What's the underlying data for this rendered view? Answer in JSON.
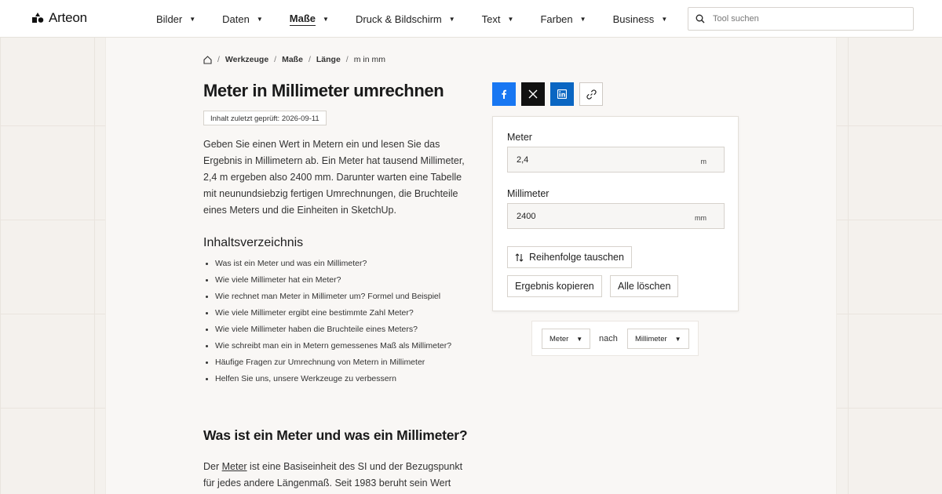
{
  "brand": {
    "name": "Arteon",
    "logo_icon": "arteon-logo-icon"
  },
  "nav": {
    "items": [
      {
        "label": "Bilder",
        "active": false
      },
      {
        "label": "Daten",
        "active": false
      },
      {
        "label": "Maße",
        "active": true
      },
      {
        "label": "Druck & Bildschirm",
        "active": false
      },
      {
        "label": "Text",
        "active": false
      },
      {
        "label": "Farben",
        "active": false
      },
      {
        "label": "Business",
        "active": false
      }
    ],
    "caret": "▼"
  },
  "search": {
    "placeholder": "Tool suchen",
    "value": ""
  },
  "breadcrumb": {
    "home_icon": "home-icon",
    "items": [
      "Werkzeuge",
      "Maße",
      "Länge"
    ],
    "current": "m in mm",
    "separator": "/"
  },
  "page": {
    "title": "Meter in Millimeter umrechnen",
    "badge": "Inhalt zuletzt geprüft: 2026-09-11",
    "intro": "Geben Sie einen Wert in Metern ein und lesen Sie das Ergebnis in Millimetern ab. Ein Meter hat tausend Millimeter, 2,4 m ergeben also 2400 mm. Darunter warten eine Tabelle mit neunundsiebzig fertigen Umrechnungen, die Bruchteile eines Meters und die Einheiten in SketchUp."
  },
  "toc": {
    "title": "Inhaltsverzeichnis",
    "items": [
      "Was ist ein Meter und was ein Millimeter?",
      "Wie viele Millimeter hat ein Meter?",
      "Wie rechnet man Meter in Millimeter um? Formel und Beispiel",
      "Wie viele Millimeter ergibt eine bestimmte Zahl Meter?",
      "Wie viele Millimeter haben die Bruchteile eines Meters?",
      "Wie schreibt man ein in Metern gemessenes Maß als Millimeter?",
      "Häufige Fragen zur Umrechnung von Metern in Millimeter",
      "Helfen Sie uns, unsere Werkzeuge zu verbessern"
    ]
  },
  "section": {
    "title": "Was ist ein Meter und was ein Millimeter?",
    "text_before": "Der ",
    "link": "Meter",
    "text_after": " ist eine Basiseinheit des SI und der Bezugspunkt für jedes andere Längenmaß. Seit 1983 beruht sein Wert"
  },
  "share": {
    "facebook_icon": "facebook-icon",
    "x_icon": "x-icon",
    "linkedin_icon": "linkedin-icon",
    "link_icon": "link-icon",
    "colors": {
      "facebook": "#1877f2",
      "x": "#111111",
      "linkedin": "#0a66c2"
    }
  },
  "converter": {
    "from": {
      "label": "Meter",
      "value": "2,4",
      "unit": "m"
    },
    "to": {
      "label": "Millimeter",
      "value": "2400",
      "unit": "mm"
    },
    "swap_label": "Reihenfolge tauschen",
    "copy_label": "Ergebnis kopieren",
    "clear_label": "Alle löschen"
  },
  "unit_select": {
    "from": "Meter",
    "connector": "nach",
    "to": "Millimeter"
  }
}
